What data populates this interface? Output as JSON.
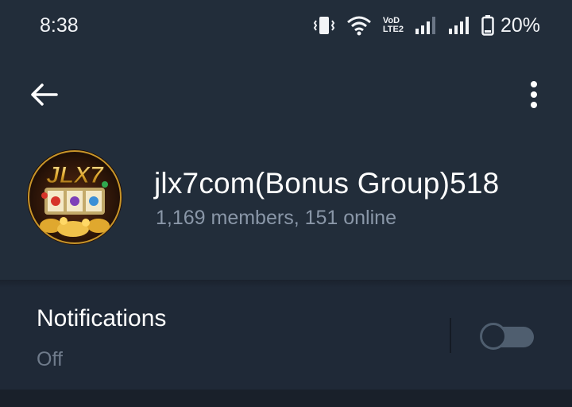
{
  "status_bar": {
    "time": "8:38",
    "volte_label_top": "VoD",
    "volte_label_bottom": "LTE2",
    "battery": "20%"
  },
  "header": {
    "back_icon": "arrow-left-icon",
    "menu_icon": "more-vertical-icon",
    "avatar_text": "JLX7",
    "title": "jlx7com(Bonus Group)518",
    "subtitle": "1,169 members, 151 online"
  },
  "notifications": {
    "label": "Notifications",
    "value": "Off",
    "toggle_on": false
  },
  "colors": {
    "header_bg": "#222d3a",
    "body_bg": "#1f2937",
    "muted_text": "#8a97a8",
    "toggle_off": "#4f5e6f"
  }
}
